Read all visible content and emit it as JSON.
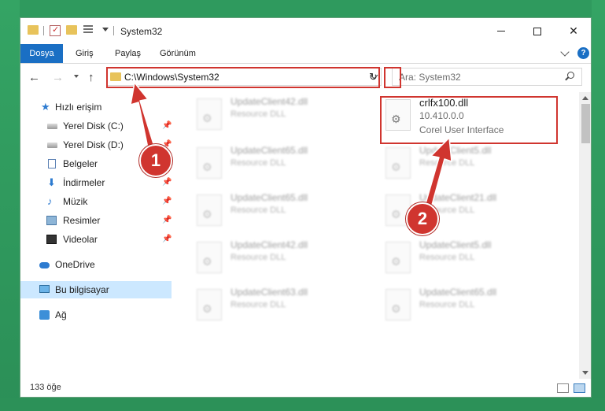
{
  "window": {
    "title": "System32",
    "quick_access_icons": [
      "folder-icon",
      "properties-icon",
      "new-folder-icon",
      "view-icon",
      "dropdown-icon"
    ]
  },
  "ribbon": {
    "tabs": [
      {
        "label": "Dosya",
        "active": true
      },
      {
        "label": "Giriş"
      },
      {
        "label": "Paylaş"
      },
      {
        "label": "Görünüm"
      }
    ],
    "help_label": "?"
  },
  "navigation": {
    "address": "C:\\Windows\\System32",
    "search_placeholder": "Ara: System32"
  },
  "sidebar": {
    "items": [
      {
        "label": "Hızlı erişim",
        "icon": "star-icon"
      },
      {
        "label": "Yerel Disk (C:)",
        "icon": "drive-icon",
        "pinned": true
      },
      {
        "label": "Yerel Disk (D:)",
        "icon": "drive-icon",
        "pinned": true
      },
      {
        "label": "Belgeler",
        "icon": "documents-icon"
      },
      {
        "label": "İndirmeler",
        "icon": "download-icon",
        "pinned": true
      },
      {
        "label": "Müzik",
        "icon": "music-icon",
        "pinned": true
      },
      {
        "label": "Resimler",
        "icon": "pictures-icon",
        "pinned": true
      },
      {
        "label": "Videolar",
        "icon": "videos-icon",
        "pinned": true
      },
      {
        "label": "OneDrive",
        "icon": "cloud-icon"
      },
      {
        "label": "Bu bilgisayar",
        "icon": "computer-icon",
        "selected": true
      },
      {
        "label": "Ağ",
        "icon": "network-icon"
      }
    ]
  },
  "files": {
    "column_left": [
      {
        "name": "UpdateClient42.dll",
        "type": "Resource DLL"
      },
      {
        "name": "UpdateClient65.dll",
        "type": "Resource DLL"
      },
      {
        "name": "UpdateClient65.dll",
        "type": "Resource DLL"
      },
      {
        "name": "UpdateClient42.dll",
        "type": "Resource DLL"
      },
      {
        "name": "UpdateClient63.dll",
        "type": "Resource DLL"
      }
    ],
    "column_right": [
      {
        "name": "crlfx100.dll",
        "version": "10.410.0.0",
        "type": "Corel User Interface",
        "highlighted": true
      },
      {
        "name": "UpdateClient5.dll",
        "type": "Resource DLL"
      },
      {
        "name": "UpdateClient21.dll",
        "type": "Resource DLL"
      },
      {
        "name": "UpdateClient5.dll",
        "type": "Resource DLL"
      },
      {
        "name": "UpdateClient65.dll",
        "type": "Resource DLL"
      }
    ]
  },
  "status": {
    "count": "133 öğe"
  },
  "annotations": {
    "step1": "1",
    "step2": "2",
    "color": "#d0352f"
  }
}
